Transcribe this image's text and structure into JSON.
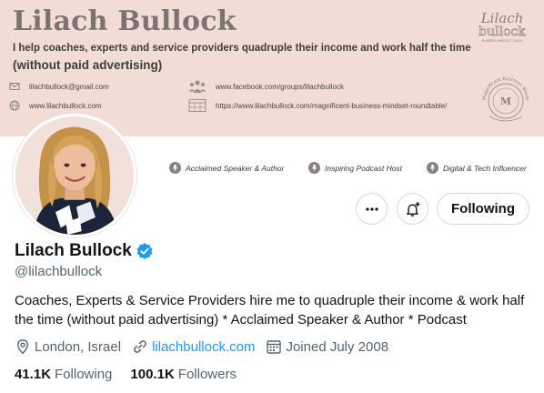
{
  "banner": {
    "title": "Lilach Bullock",
    "tagline": "I help coaches, experts and service providers quadruple their income and work half the time",
    "tagline2": "(without paid advertising)",
    "email": "lilachbullock@gmail.com",
    "website": "www.lilachbullock.com",
    "facebook": "www.facebook.com/groups/lilachbullock",
    "roundtable": "https://www.lilachbullock.com/magnificent-business-mindset-roundtable/",
    "logo_text": "Lilach bullock",
    "logo_subtext": "BUSINESS MINDSET COACH",
    "seal_text": "Magnificent Business Mindset"
  },
  "badges": [
    {
      "label": "Acclaimed Speaker & Author",
      "icon": "microphone-icon"
    },
    {
      "label": "Inspiring Podcast Host",
      "icon": "microphone-icon"
    },
    {
      "label": "Digital & Tech Influencer",
      "icon": "microphone-icon"
    }
  ],
  "actions": {
    "more_icon": "more-dots-icon",
    "notify_icon": "bell-plus-icon",
    "follow_label": "Following"
  },
  "profile": {
    "name": "Lilach Bullock",
    "handle": "@lilachbullock",
    "bio": "Coaches, Experts & Service Providers hire me to quadruple their income & work half the time (without paid advertising) * Acclaimed Speaker & Author * Podcast",
    "location": "London, Israel",
    "website": "lilachbullock.com",
    "joined": "Joined July 2008"
  },
  "stats": {
    "following_count": "41.1K",
    "following_label": "Following",
    "followers_count": "100.1K",
    "followers_label": "Followers"
  },
  "colors": {
    "banner_bg": "#f2dcd6",
    "link": "#1d9bf0",
    "verified": "#1d9bf0",
    "secondary_text": "#536471"
  }
}
